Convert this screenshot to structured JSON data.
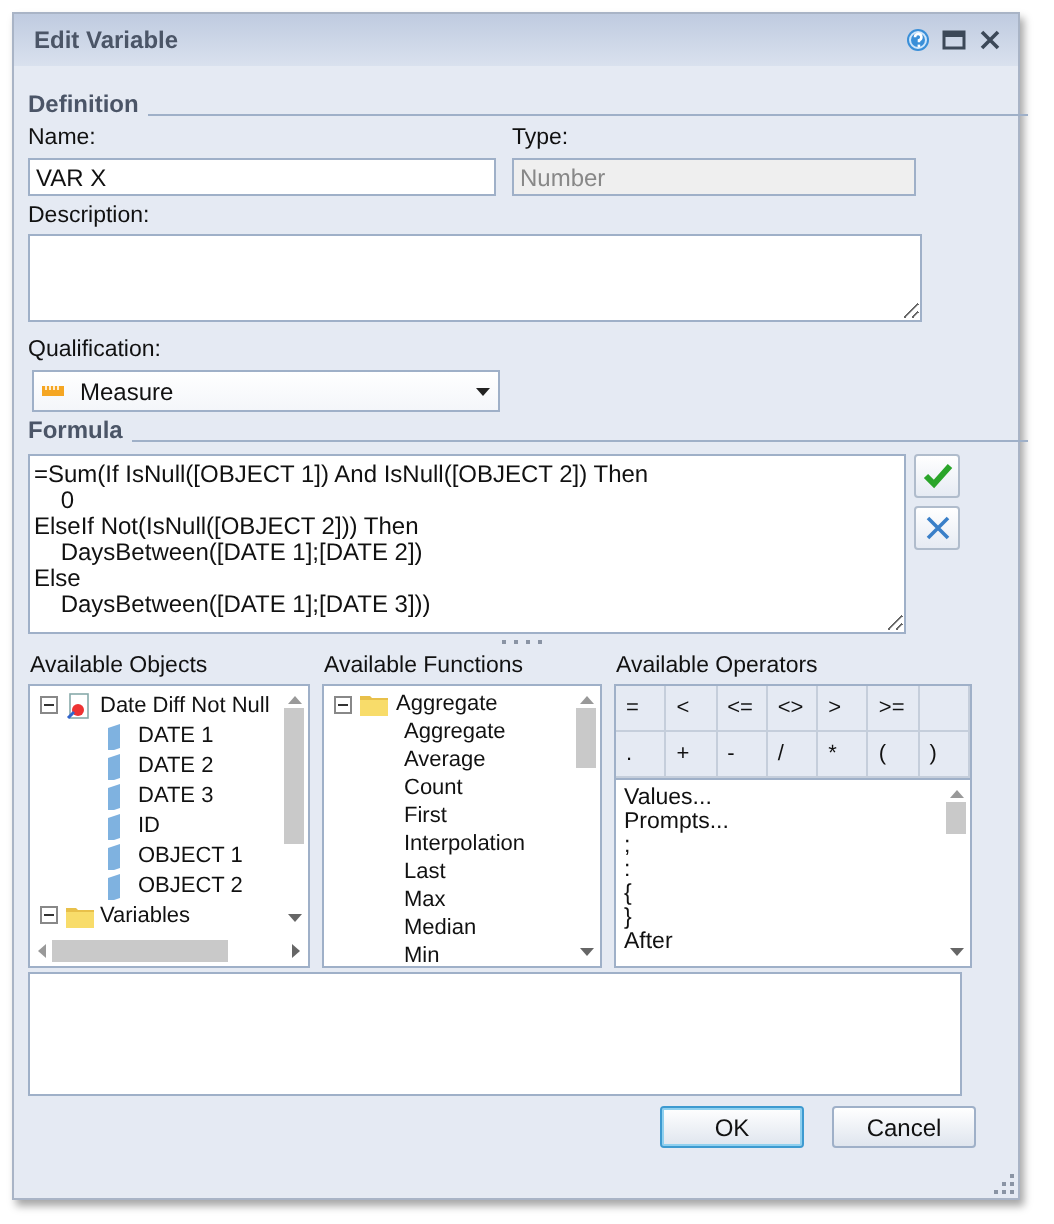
{
  "window": {
    "title": "Edit Variable"
  },
  "definition": {
    "heading": "Definition",
    "name": {
      "label": "Name:",
      "value": "VAR X"
    },
    "type": {
      "label": "Type:",
      "value": "Number",
      "disabled": true
    },
    "description": {
      "label": "Description:"
    },
    "qualification": {
      "label": "Qualification:",
      "value": "Measure"
    }
  },
  "formula": {
    "heading": "Formula",
    "lines": [
      "=Sum(If IsNull([OBJECT 1]) And IsNull([OBJECT 2]) Then",
      "    0",
      "ElseIf Not(IsNull([OBJECT 2])) Then",
      "    DaysBetween([DATE 1];[DATE 2])",
      "Else",
      "    DaysBetween([DATE 1];[DATE 3]))"
    ]
  },
  "objects": {
    "heading": "Available Objects",
    "tree": [
      {
        "label": "Date Diff Not Null",
        "kind": "universe",
        "expanded": true,
        "children": [
          {
            "label": "DATE 1",
            "kind": "object"
          },
          {
            "label": "DATE 2",
            "kind": "object"
          },
          {
            "label": "DATE 3",
            "kind": "object"
          },
          {
            "label": "ID",
            "kind": "object"
          },
          {
            "label": "OBJECT 1",
            "kind": "object"
          },
          {
            "label": "OBJECT 2",
            "kind": "object"
          }
        ]
      },
      {
        "label": "Variables",
        "kind": "folder",
        "expanded": true
      }
    ]
  },
  "functions": {
    "heading": "Available Functions",
    "tree": [
      {
        "label": "Aggregate",
        "kind": "folder",
        "expanded": true,
        "children": [
          {
            "label": "Aggregate"
          },
          {
            "label": "Average"
          },
          {
            "label": "Count"
          },
          {
            "label": "First"
          },
          {
            "label": "Interpolation"
          },
          {
            "label": "Last"
          },
          {
            "label": "Max"
          },
          {
            "label": "Median"
          },
          {
            "label": "Min"
          }
        ]
      }
    ]
  },
  "operators": {
    "heading": "Available Operators",
    "keys": [
      [
        "=",
        "<",
        "<=",
        "<>",
        ">",
        ">="
      ],
      [
        ".",
        "+",
        "-",
        "/",
        "*",
        "(",
        ")"
      ]
    ],
    "list": [
      "Values...",
      "Prompts...",
      ";",
      ":",
      "{",
      "}",
      "After"
    ]
  },
  "buttons": [
    {
      "label": "OK",
      "default": true
    },
    {
      "label": "Cancel",
      "default": false
    }
  ]
}
